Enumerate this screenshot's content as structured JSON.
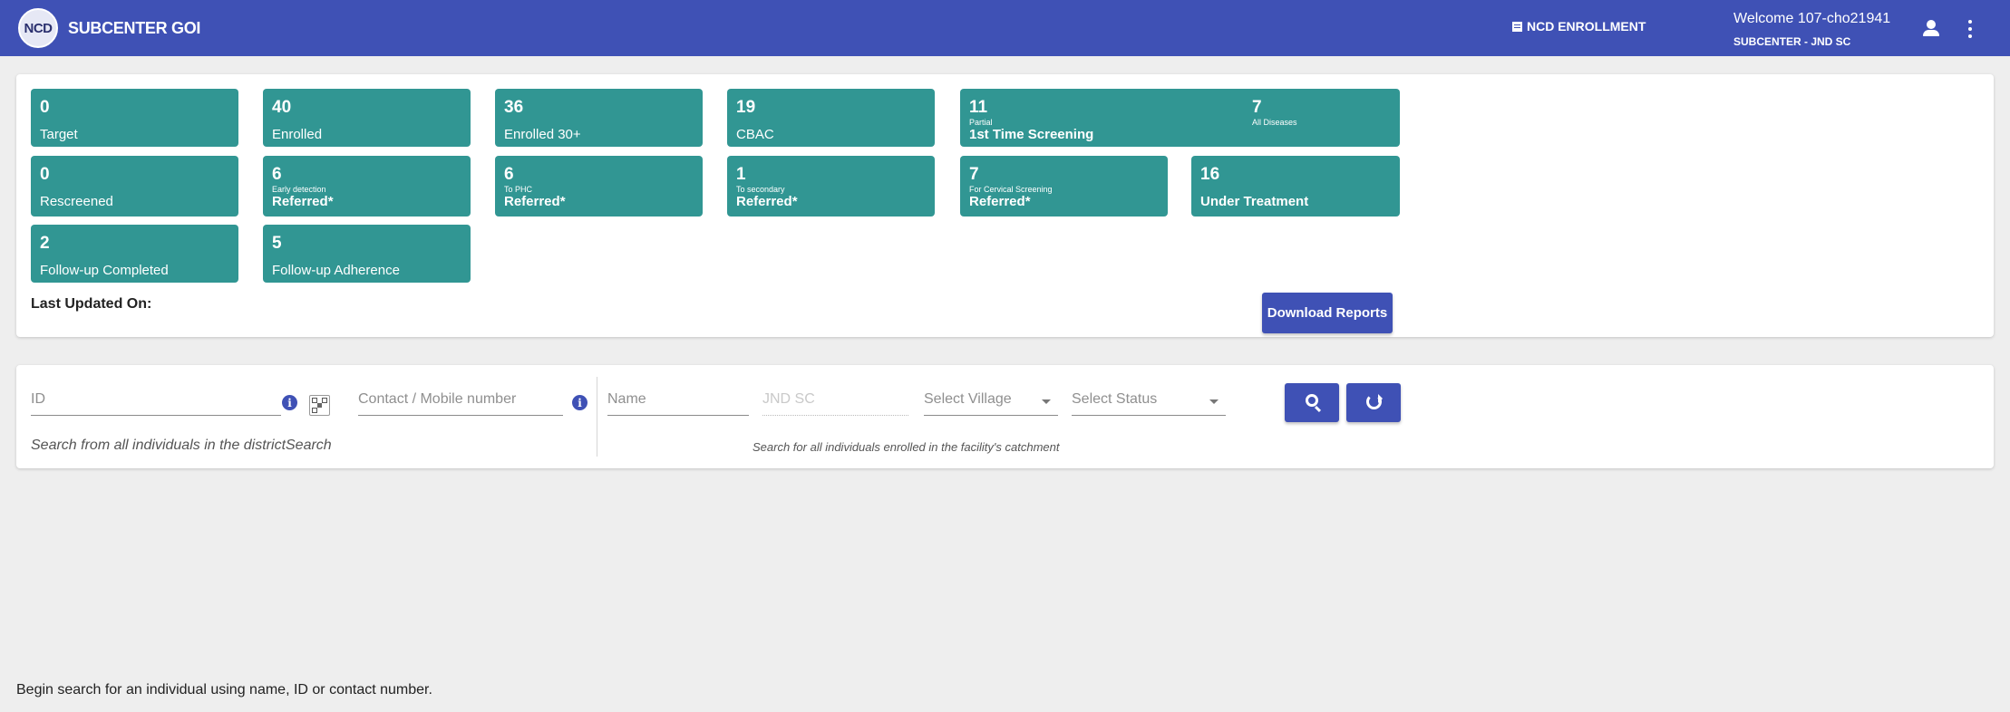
{
  "header": {
    "logo_text": "NCD",
    "title": "SUBCENTER GOI",
    "nav_link": "NCD ENROLLMENT",
    "welcome": "Welcome 107-cho21941",
    "facility": "SUBCENTER - JND SC",
    "icons": [
      "document-icon",
      "user-icon",
      "more-vert-icon"
    ]
  },
  "dashboard": {
    "tiles": [
      {
        "value": "0",
        "label": "Target"
      },
      {
        "value": "40",
        "label": "Enrolled"
      },
      {
        "value": "36",
        "label": "Enrolled 30+"
      },
      {
        "value": "19",
        "label": "CBAC"
      },
      {
        "value": "11",
        "sub": "Partial",
        "label": "1st Time Screening",
        "value2": "7",
        "sub2": "All Diseases"
      },
      {
        "value": "0",
        "label": "Rescreened"
      },
      {
        "value": "6",
        "sub": "Early detection",
        "label": "Referred*"
      },
      {
        "value": "6",
        "sub": "To PHC",
        "label": "Referred*"
      },
      {
        "value": "1",
        "sub": "To secondary",
        "label": "Referred*"
      },
      {
        "value": "7",
        "sub": "For Cervical Screening",
        "label": "Referred*"
      },
      {
        "value": "16",
        "label": "Under Treatment"
      },
      {
        "value": "2",
        "label": "Follow-up Completed"
      },
      {
        "value": "5",
        "label": "Follow-up Adherence"
      }
    ],
    "last_updated_label": "Last Updated On:",
    "download_label": "Download Reports"
  },
  "search": {
    "id_placeholder": "ID",
    "contact_placeholder": "Contact / Mobile number",
    "district_hint": "Search from all individuals in the districtSearch",
    "name_placeholder": "Name",
    "facility_value": "JND SC",
    "village_placeholder": "Select Village",
    "status_placeholder": "Select Status",
    "facility_hint": "Search for all individuals enrolled in the facility's catchment",
    "icons": [
      "info-icon",
      "qr-scan-icon",
      "search-icon",
      "refresh-icon"
    ]
  },
  "footer": {
    "message": "Begin search for an individual using name, ID or contact number."
  },
  "colors": {
    "header": "#3f51b5",
    "tile": "#319693",
    "button": "#3f51b5",
    "background": "#eeeeee"
  }
}
